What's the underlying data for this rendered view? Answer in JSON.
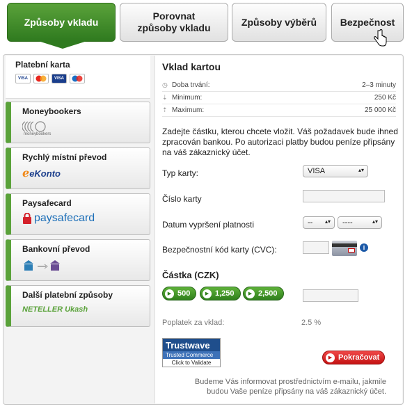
{
  "tabs": [
    {
      "label": "Způsoby vkladu",
      "active": true
    },
    {
      "label": "Porovnat způsoby vkladu",
      "active": false
    },
    {
      "label": "Způsoby výběrů",
      "active": false
    },
    {
      "label": "Bezpečnost",
      "active": false
    }
  ],
  "sidebar": {
    "card": {
      "title": "Platební karta",
      "logos": [
        "VISA",
        "MC",
        "VISA",
        "Maestro"
      ]
    },
    "methods": [
      {
        "name": "Moneybookers",
        "logo_text": "moneybookers"
      },
      {
        "name": "Rychlý místní převod",
        "logo_text": "eKonto"
      },
      {
        "name": "Paysafecard",
        "logo_text": "paysafecard"
      },
      {
        "name": "Bankovní převod",
        "logo_text": ""
      },
      {
        "name": "Další platební způsoby",
        "logo_text": "NETELLER  Ukash"
      }
    ]
  },
  "main": {
    "title": "Vklad kartou",
    "info": [
      {
        "label": "Doba trvání:",
        "value": "2–3 minuty"
      },
      {
        "label": "Minimum:",
        "value": "250 Kč"
      },
      {
        "label": "Maximum:",
        "value": "25 000 Kč"
      }
    ],
    "description": "Zadejte částku, kterou chcete vložit. Váš požadavek bude ihned zpracován bankou. Po autorizaci platby budou peníze připsány na váš zákaznický účet.",
    "card_type_label": "Typ karty:",
    "card_type_value": "VISA",
    "card_number_label": "Číslo karty",
    "expiry_label": "Datum vypršení platnosti",
    "expiry_month": "--",
    "expiry_year": "----",
    "cvc_label": "Bezpečnostní kód karty (CVC):",
    "amount_title": "Částka (CZK)",
    "amount_buttons": [
      "500",
      "1,250",
      "2,500"
    ],
    "fee_label": "Poplatek za vklad:",
    "fee_value": "2.5 %",
    "trust": {
      "line1": "Trustwave",
      "line2": "Trusted Commerce",
      "line3": "Click to Validate"
    },
    "continue_label": "Pokračovat",
    "footer": "Budeme Vás informovat prostřednictvím e-mailu, jakmile budou Vaše peníze připsány na váš zákaznický účet."
  },
  "colors": {
    "accent": "#2f7a1f",
    "continue": "#c41212"
  }
}
